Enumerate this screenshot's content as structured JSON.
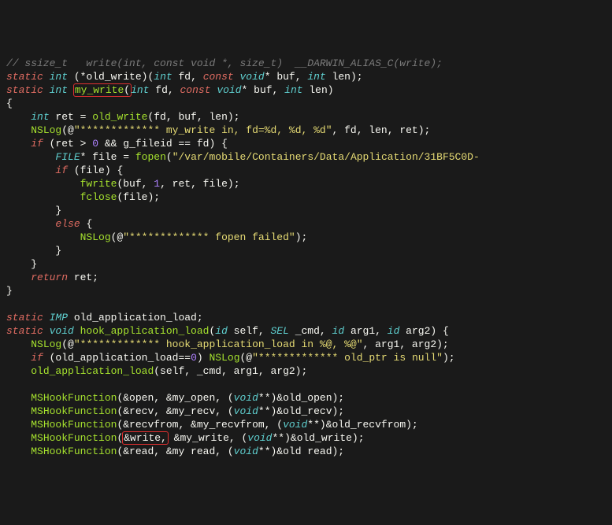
{
  "code": {
    "l01_comment": "// ssize_t   write(int, const void *, size_t)  __DARWIN_ALIAS_C(write);",
    "l02": {
      "kw1": "static",
      "type1": "int",
      "punc1": " (*",
      "ident1": "old_write",
      "punc2": ")(",
      "type2": "int",
      "ident2": " fd",
      "punc3": ", ",
      "kw2": "const",
      "type3": " void",
      "punc4": "* ",
      "ident3": "buf",
      "punc5": ", ",
      "type4": "int",
      "ident4": " len",
      "punc6": ");"
    },
    "l03": {
      "kw1": "static",
      "type1": "int ",
      "fn": "my_write",
      "open": "(",
      "type2": "int",
      "ident2": " fd",
      "punc3": ", ",
      "kw2": "const",
      "type3": " void",
      "punc4": "* ",
      "ident3": "buf",
      "punc5": ", ",
      "type4": "int",
      "ident4": " len",
      "punc6": ")"
    },
    "l04": "{",
    "l05": {
      "pad": "    ",
      "type": "int",
      "rest1": " ret = ",
      "call": "old_write",
      "rest2": "(fd, buf, len);"
    },
    "l06": {
      "pad": "    ",
      "fn": "NSLog",
      "open": "(@",
      "str": "\"************* my_write in, fd=%d, %d, %d\"",
      "rest": ", fd, len, ret);"
    },
    "l07": {
      "pad": "    ",
      "kw": "if",
      "rest1": " (ret > ",
      "num": "0",
      "rest2": " && g_fileid == fd) {"
    },
    "l08": {
      "pad": "        ",
      "type": "FILE",
      "punc1": "* ",
      "ident": "file",
      "rest1": " = ",
      "fn": "fopen",
      "open": "(",
      "str": "\"/var/mobile/Containers/Data/Application/31BF5C0D-"
    },
    "l09": {
      "pad": "        ",
      "kw": "if",
      "rest": " (file) {"
    },
    "l10": {
      "pad": "            ",
      "fn": "fwrite",
      "open": "(",
      "rest1": "buf, ",
      "num": "1",
      "rest2": ", ret, file);"
    },
    "l11": {
      "pad": "            ",
      "fn": "fclose",
      "rest": "(file);"
    },
    "l12": "        }",
    "l13": {
      "pad": "        ",
      "kw": "else",
      "rest": " {"
    },
    "l14": {
      "pad": "            ",
      "fn": "NSLog",
      "open": "(@",
      "str": "\"************* fopen failed\"",
      "close": ");"
    },
    "l15": "        }",
    "l16": "    }",
    "l17": {
      "pad": "    ",
      "kw": "return",
      "rest": " ret;"
    },
    "l18": "}",
    "l19": "",
    "l20": {
      "kw": "static",
      "type": " IMP",
      "rest": " old_application_load;"
    },
    "l21": {
      "kw1": "static",
      "type1": " void ",
      "fn": "hook_application_load",
      "open": "(",
      "type2": "id",
      "a1": " self",
      "p1": ", ",
      "type3": "SEL",
      "a2": " _cmd",
      "p2": ", ",
      "type4": "id",
      "a3": " arg1",
      "p3": ", ",
      "type5": "id",
      "a4": " arg2",
      "close": ") {"
    },
    "l22": {
      "pad": "    ",
      "fn": "NSLog",
      "open": "(@",
      "str": "\"************* hook_application_load in %@, %@\"",
      "rest": ", arg1, arg2);"
    },
    "l23": {
      "pad": "    ",
      "kw": "if",
      "rest1": " (old_application_load==",
      "num": "0",
      "rest2": ") ",
      "fn": "NSLog",
      "open": "(@",
      "str": "\"************* old_ptr is null\"",
      "close": ");"
    },
    "l24": {
      "pad": "    ",
      "fn": "old_application_load",
      "rest": "(self, _cmd, arg1, arg2);"
    },
    "l25": "",
    "l26": {
      "pad": "    ",
      "fn": "MSHookFunction",
      "rest1": "(&open, &my_open, (",
      "type": "void",
      "rest2": "**)&old_open);"
    },
    "l27": {
      "pad": "    ",
      "fn": "MSHookFunction",
      "rest1": "(&recv, &my_recv, (",
      "type": "void",
      "rest2": "**)&old_recv);"
    },
    "l28": {
      "pad": "    ",
      "fn": "MSHookFunction",
      "rest1": "(&recvfrom, &my_recvfrom, (",
      "type": "void",
      "rest2": "**)&old_recvfrom);"
    },
    "l29": {
      "pad": "    ",
      "fn": "MSHookFunction",
      "open": "(",
      "hl": "&write,",
      "rest1": " &my_write, (",
      "type": "void",
      "rest2": "**)&old_write);"
    },
    "l30": {
      "pad": "    ",
      "fn": "MSHookFunction",
      "rest1": "(&read, &my read, (",
      "type": "void",
      "rest2": "**)&old read);"
    }
  }
}
